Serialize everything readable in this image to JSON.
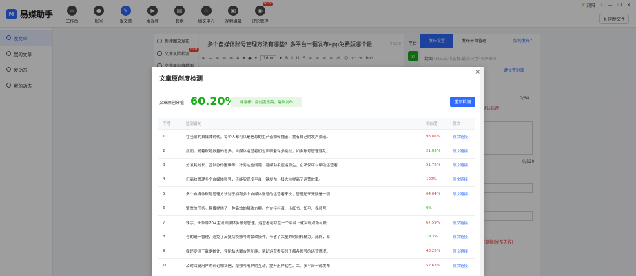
{
  "app": {
    "name": "易媒助手",
    "logo_letter": "M"
  },
  "nav": [
    {
      "label": "工作台",
      "icon": "home-icon",
      "glyph": "⌂"
    },
    {
      "label": "账号",
      "icon": "user-icon",
      "glyph": "●"
    },
    {
      "label": "发文章",
      "icon": "pen-icon",
      "glyph": "✎",
      "active": true
    },
    {
      "label": "发视频",
      "icon": "video-icon",
      "glyph": "▶"
    },
    {
      "label": "数据",
      "icon": "chart-icon",
      "glyph": "▤"
    },
    {
      "label": "爆文中心",
      "icon": "fire-icon",
      "glyph": "♨"
    },
    {
      "label": "视频编辑",
      "icon": "film-icon",
      "glyph": "▣"
    },
    {
      "label": "评论管理",
      "icon": "comment-icon",
      "glyph": "◉",
      "badge": "NEW"
    }
  ],
  "user": {
    "name": "刘阳",
    "controls": [
      "?",
      "—",
      "❐",
      "✕"
    ]
  },
  "sync_button": "同步文件",
  "sidebar": [
    {
      "label": "发文章",
      "active": true
    },
    {
      "label": "我的文章"
    },
    {
      "label": "发动态"
    },
    {
      "label": "我的动态"
    }
  ],
  "midpanel": [
    {
      "label": "新建图文发布"
    },
    {
      "label": "文章风险检测",
      "badge": "NEW"
    },
    {
      "label": "文章原创度检测"
    }
  ],
  "editor": {
    "title": "多个自媒体账号管理方法有哪些？多平台一键发布app免费版哪个最",
    "count": "28/30",
    "toolbar": [
      "⊞",
      "⊟",
      "≡",
      "≡",
      "≣",
      "A",
      "▾",
      "◆",
      "▾",
      "16px",
      "▾",
      "B",
      "I",
      "U",
      "S",
      "≡",
      "≡",
      "≡",
      "≡",
      "☍",
      "☺",
      "↶",
      "↷",
      "bod"
    ]
  },
  "right_panel": {
    "platform_label": "平台",
    "tabs": [
      "发布设置",
      "发布平台管理"
    ],
    "help": "如何发布?",
    "cover_label": "封面",
    "cover_hint": "(从正文中选择,最小尺寸400*300)",
    "cover_link": "一键设置封面",
    "count_1": "0/64",
    "count_2": "0/120",
    "warning_1": "默认标题",
    "warning_2": "存草稿(发布失败)"
  },
  "modal": {
    "title": "文章原创度检测",
    "score_label": "文章原创分值",
    "score_value": "60.20%",
    "score_tag": "非常棒！原创度很高，建议发布",
    "recheck": "重新检测",
    "headers": [
      "序号",
      "监测语句",
      "相似度",
      "原文"
    ],
    "rows": [
      {
        "no": "1",
        "text": "在当前的自媒体时代，每个人都可以是信息的生产者和传播者，拥有自己的发声渠道。",
        "rate": "93.86%",
        "level": "high",
        "link": "原文链接"
      },
      {
        "no": "2",
        "text": "然而，随着账号数量的增多，自媒体运营者们也面临着许多挑战，如多账号管理混乱、",
        "rate": "21.05%",
        "level": "low",
        "link": "原文链接"
      },
      {
        "no": "3",
        "text": "分发耗时长、团队协作困难等。针对这些问题，易媒助手应运而生，它不仅可以帮助运营者",
        "rate": "51.75%",
        "level": "mid",
        "link": "原文链接"
      },
      {
        "no": "4",
        "text": "们高效管理多个自媒体账号，还能实现多平台一键发布，极大地提高了运营效率。一、",
        "rate": "100%",
        "level": "high",
        "link": "原文链接"
      },
      {
        "no": "5",
        "text": "多个自媒体账号管理方法对于拥有多个自媒体账号的运营者来说，管理起来无疑是一项",
        "rate": "64.04%",
        "level": "mid",
        "link": "原文链接"
      },
      {
        "no": "6",
        "text": "繁重的任务。易媒提供了一种高效的解决方案。它支持抖音、小红书、知乎、视频号、",
        "rate": "0%",
        "level": "low",
        "link": "---"
      },
      {
        "no": "7",
        "text": "快手、头条等70+主流自媒体多账号管理，运营者可以在一个平台上就实现对所有账",
        "rate": "67.59%",
        "level": "mid",
        "link": "原文链接"
      },
      {
        "no": "8",
        "text": "号的统一管理，避免了反复切换账号的繁琐操作，节省了大量的时间和精力。此外，易",
        "rate": "19.3%",
        "level": "low",
        "link": "原文链接"
      },
      {
        "no": "9",
        "text": "媒还提供了数据统计、评论私信聚合等功能，帮助运营者实时了解各账号的运营情况，",
        "rate": "48.25%",
        "level": "mid",
        "link": "原文链接"
      },
      {
        "no": "10",
        "text": "及时回复用户的评论和私信，增强与用户的互动，提升用户粘性。二、多平台一键发布",
        "rate": "52.63%",
        "level": "mid",
        "link": "原文链接"
      }
    ]
  }
}
